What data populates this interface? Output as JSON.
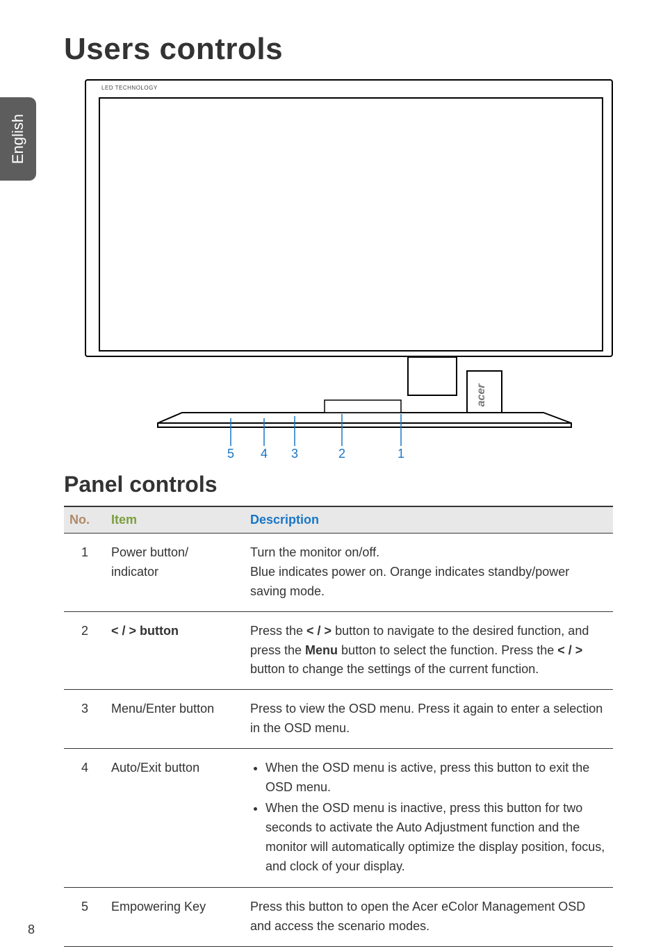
{
  "sidebar": {
    "language": "English"
  },
  "headings": {
    "h1": "Users controls",
    "h2": "Panel controls"
  },
  "diagram": {
    "led_label": "LED TECHNOLOGY",
    "logo": "acer",
    "callouts": [
      "5",
      "4",
      "3",
      "2",
      "1"
    ]
  },
  "table": {
    "headers": {
      "no": "No.",
      "item": "Item",
      "description": "Description"
    },
    "rows": [
      {
        "no": "1",
        "item": "Power button/ indicator",
        "desc_lines": [
          "Turn the monitor on/off.",
          "Blue indicates power on. Orange indicates standby/power saving mode."
        ]
      },
      {
        "no": "2",
        "item": "< / > button",
        "desc_pre": "Press the ",
        "desc_btn1": "< / >",
        "desc_mid1": " button to navigate to the desired function, and press the ",
        "desc_menu": "Menu",
        "desc_mid2": " button to select the function. Press the ",
        "desc_btn2": "< / >",
        "desc_post": " button to change the settings of the current function."
      },
      {
        "no": "3",
        "item": "Menu/Enter button",
        "desc": "Press to view the OSD menu. Press it again to enter a selection in the OSD menu."
      },
      {
        "no": "4",
        "item": "Auto/Exit button",
        "bullets": [
          "When the OSD menu is active, press this button to exit the OSD menu.",
          "When the OSD menu is inactive, press this button for two seconds to activate the Auto Adjustment function and the monitor will automatically optimize the display position, focus, and clock of your display."
        ]
      },
      {
        "no": "5",
        "item": "Empowering Key",
        "desc": "Press this button to open the Acer eColor Management OSD and access the scenario modes."
      }
    ]
  },
  "page_number": "8"
}
